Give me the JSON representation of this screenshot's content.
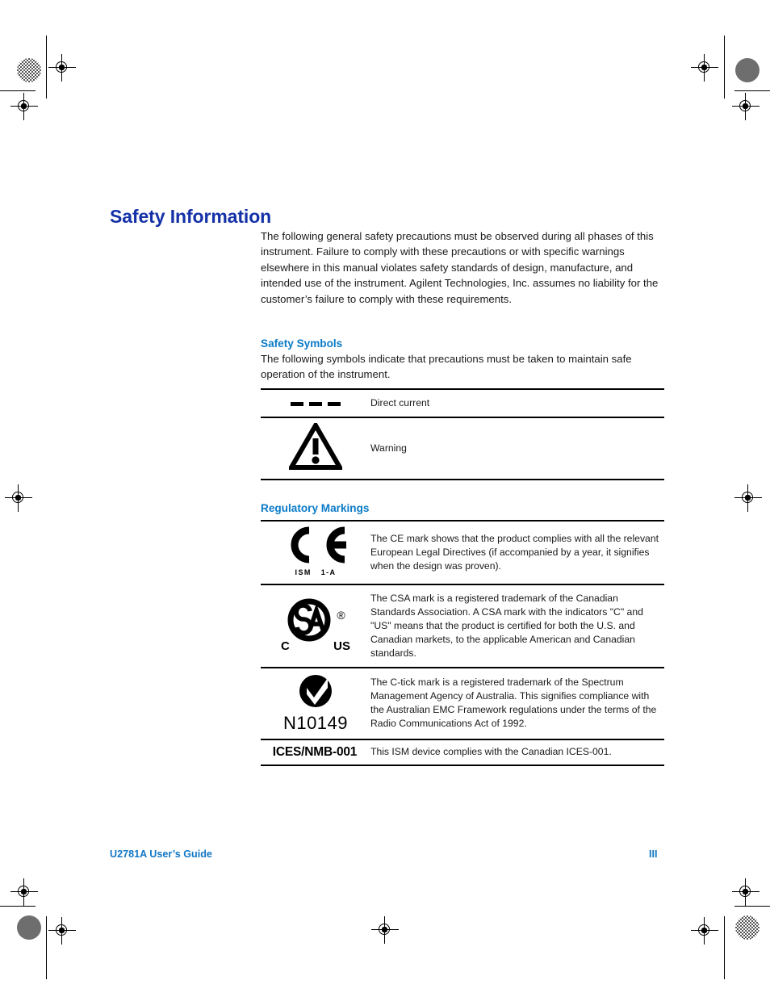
{
  "document": {
    "title": "Safety Information",
    "intro": "The following general safety precautions must be observed during all phases of this instrument. Failure to comply with these precautions or with specific warnings elsewhere in this manual violates safety standards of design, manufacture, and intended use of the instrument. Agilent Technologies, Inc. assumes no liability for the customer’s failure to comply with these requirements."
  },
  "safety_symbols": {
    "heading": "Safety Symbols",
    "intro": "The following symbols indicate that precautions must be taken to maintain safe operation of the instrument.",
    "rows": [
      {
        "symbol": "direct-current-symbol",
        "description": "Direct current"
      },
      {
        "symbol": "warning-triangle-symbol",
        "description": "Warning"
      }
    ]
  },
  "regulatory_markings": {
    "heading": "Regulatory Markings",
    "rows": [
      {
        "symbol": "ce-mark",
        "label_ism": "ISM",
        "label_class": "1-A",
        "description": "The CE mark shows that the product complies with all the relevant European Legal Directives (if accompanied by a year, it signifies when the design was proven)."
      },
      {
        "symbol": "csa-mark",
        "label_left": "C",
        "label_right": "US",
        "label_registered": "®",
        "description": "The CSA mark is a registered trademark of the Canadian Standards Association. A CSA mark with the indicators \"C\" and \"US\" means that the product is certified for both the U.S. and Canadian markets, to the applicable American and Canadian standards."
      },
      {
        "symbol": "c-tick-mark",
        "label_number": "N10149",
        "description": "The C-tick mark is a registered trademark of the Spectrum Management Agency of Australia. This signifies compliance with the Australian EMC Framework regulations under the terms of the Radio Communications Act of 1992."
      },
      {
        "symbol": "ices-nmb-text-mark",
        "label_text": "ICES/NMB-001",
        "description": "This ISM device complies with the Canadian ICES-001."
      }
    ]
  },
  "footer": {
    "guide_title": "U2781A User’s Guide",
    "page_number": "III"
  },
  "colors": {
    "title_blue": "#1531a8",
    "heading_blue": "#0b7bc8",
    "footer_blue": "#1277c4",
    "rule_black": "#000000"
  }
}
